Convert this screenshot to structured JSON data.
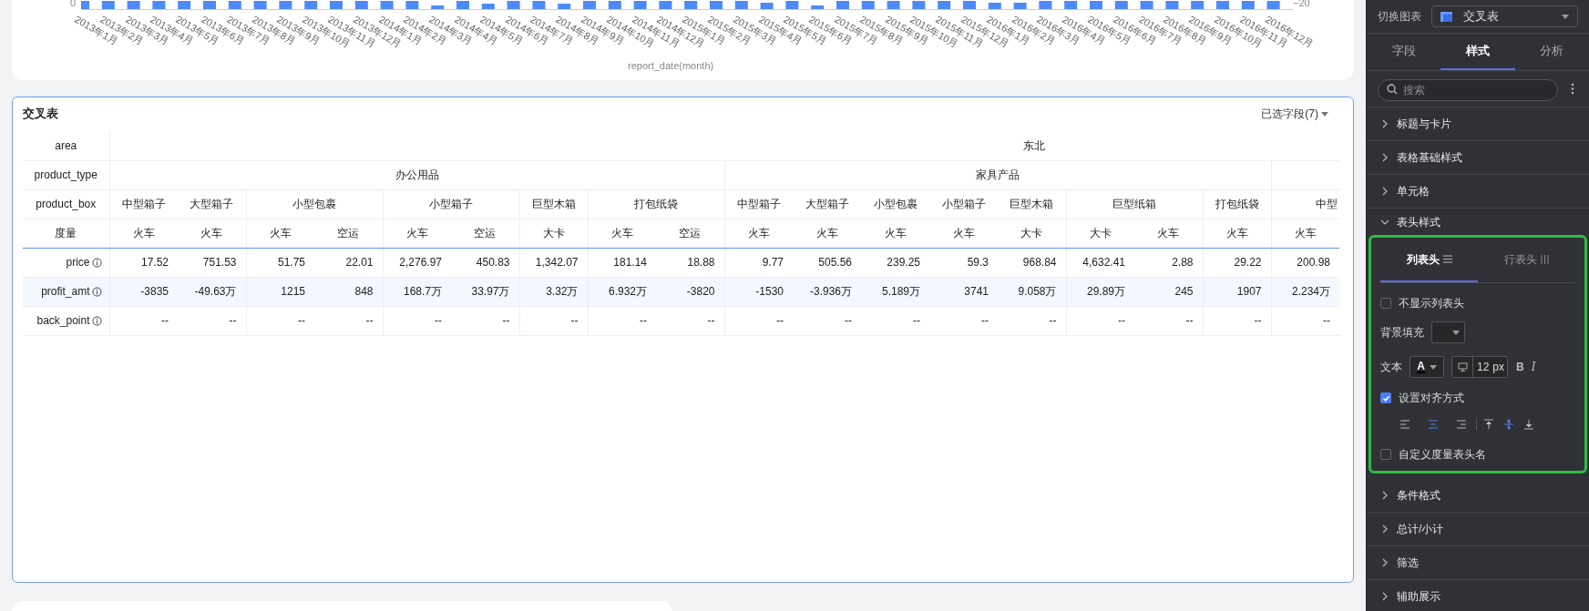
{
  "chart": {
    "left_tick": "0",
    "right_tick": "−20",
    "axis_title": "report_date(month)",
    "x_labels": [
      "2013年1月",
      "2013年2月",
      "2013年3月",
      "2013年4月",
      "2013年5月",
      "2013年6月",
      "2013年7月",
      "2013年8月",
      "2013年9月",
      "2013年10月",
      "2013年11月",
      "2013年12月",
      "2014年1月",
      "2014年2月",
      "2014年3月",
      "2014年4月",
      "2014年5月",
      "2014年6月",
      "2014年7月",
      "2014年8月",
      "2014年9月",
      "2014年10月",
      "2014年11月",
      "2014年12月",
      "2015年1月",
      "2015年2月",
      "2015年3月",
      "2015年4月",
      "2015年5月",
      "2015年6月",
      "2015年7月",
      "2015年8月",
      "2015年9月",
      "2015年10月",
      "2015年11月",
      "2015年12月",
      "2016年1月",
      "2016年2月",
      "2016年3月",
      "2016年4月",
      "2016年5月",
      "2016年6月",
      "2016年7月",
      "2016年8月",
      "2016年9月",
      "2016年10月",
      "2016年11月",
      "2016年12月"
    ]
  },
  "table_card": {
    "title": "交叉表",
    "fields_button": "已选字段(7)",
    "row_headers": [
      "area",
      "product_type",
      "product_box",
      "度量"
    ],
    "area": "东北",
    "types": [
      {
        "label": "办公用品",
        "boxes": [
          {
            "label": "中型箱子",
            "modes": [
              "火车"
            ]
          },
          {
            "label": "大型箱子",
            "modes": [
              "火车"
            ]
          },
          {
            "label": "小型包裹",
            "modes": [
              "火车",
              "空运"
            ]
          },
          {
            "label": "小型箱子",
            "modes": [
              "火车",
              "空运"
            ]
          },
          {
            "label": "巨型木箱",
            "modes": [
              "大卡"
            ]
          },
          {
            "label": "打包纸袋",
            "modes": [
              "火车",
              "空运"
            ]
          }
        ]
      },
      {
        "label": "家具产品",
        "boxes": [
          {
            "label": "中型箱子",
            "modes": [
              "火车"
            ]
          },
          {
            "label": "大型箱子",
            "modes": [
              "火车"
            ]
          },
          {
            "label": "小型包裹",
            "modes": [
              "火车"
            ]
          },
          {
            "label": "小型箱子",
            "modes": [
              "火车"
            ]
          },
          {
            "label": "巨型木箱",
            "modes": [
              "大卡"
            ]
          },
          {
            "label": "巨型纸箱",
            "modes": [
              "大卡",
              "火车"
            ]
          },
          {
            "label": "打包纸袋",
            "modes": [
              "火车"
            ]
          }
        ]
      },
      {
        "boxes": [
          {
            "label": "中型",
            "modes": [
              "火车"
            ]
          }
        ]
      }
    ],
    "rows": [
      {
        "label": "price",
        "values": [
          "17.52",
          "751.53",
          "51.75",
          "22.01",
          "2,276.97",
          "450.83",
          "1,342.07",
          "181.14",
          "18.88",
          "9.77",
          "505.56",
          "239.25",
          "59.3",
          "968.84",
          "4,632.41",
          "2.88",
          "29.22",
          "200.98"
        ]
      },
      {
        "label": "profit_amt",
        "values": [
          "-3835",
          "-49.63万",
          "1215",
          "848",
          "168.7万",
          "33.97万",
          "3.32万",
          "6.932万",
          "-3820",
          "-1530",
          "-3.936万",
          "5.189万",
          "3741",
          "9.058万",
          "29.89万",
          "245",
          "1907",
          "2.234万"
        ]
      },
      {
        "label": "back_point",
        "values": [
          "--",
          "--",
          "--",
          "--",
          "--",
          "--",
          "--",
          "--",
          "--",
          "--",
          "--",
          "--",
          "--",
          "--",
          "--",
          "--",
          "--",
          "--"
        ]
      }
    ]
  },
  "panel": {
    "switch_label": "切换图表",
    "chart_type": "交叉表",
    "tabs": [
      {
        "label": "字段",
        "selected": false
      },
      {
        "label": "样式",
        "selected": true
      },
      {
        "label": "分析",
        "selected": false
      }
    ],
    "search": {
      "placeholder": "搜索"
    },
    "sections": [
      {
        "label": "标题与卡片",
        "expanded": false
      },
      {
        "label": "表格基础样式",
        "expanded": false
      },
      {
        "label": "单元格",
        "expanded": false
      },
      {
        "label": "表头样式",
        "expanded": true
      },
      {
        "label": "条件格式",
        "expanded": false
      },
      {
        "label": "总计/小计",
        "expanded": false
      },
      {
        "label": "筛选",
        "expanded": false
      },
      {
        "label": "辅助展示",
        "expanded": false
      }
    ],
    "header_style": {
      "highlighted": true,
      "tabs": [
        {
          "label": "列表头",
          "kind": "rows",
          "selected": true
        },
        {
          "label": "行表头",
          "kind": "columns",
          "selected": false
        }
      ],
      "hide_header": {
        "label": "不显示列表头",
        "checked": false
      },
      "bg_fill_label": "背景填充",
      "text_label": "文本",
      "font_glyph": "A",
      "font_size": "12",
      "font_unit": "px",
      "bold": "B",
      "italic": "I",
      "align": {
        "label": "设置对齐方式",
        "checked": true
      },
      "h_align": [
        {
          "kind": "left",
          "selected": false
        },
        {
          "kind": "center",
          "selected": true
        },
        {
          "kind": "right",
          "selected": false
        }
      ],
      "v_align": [
        {
          "kind": "top",
          "selected": false
        },
        {
          "kind": "middle",
          "selected": true
        },
        {
          "kind": "bottom",
          "selected": false
        }
      ],
      "custom_name": {
        "label": "自定义度量表头名",
        "checked": false
      }
    }
  }
}
